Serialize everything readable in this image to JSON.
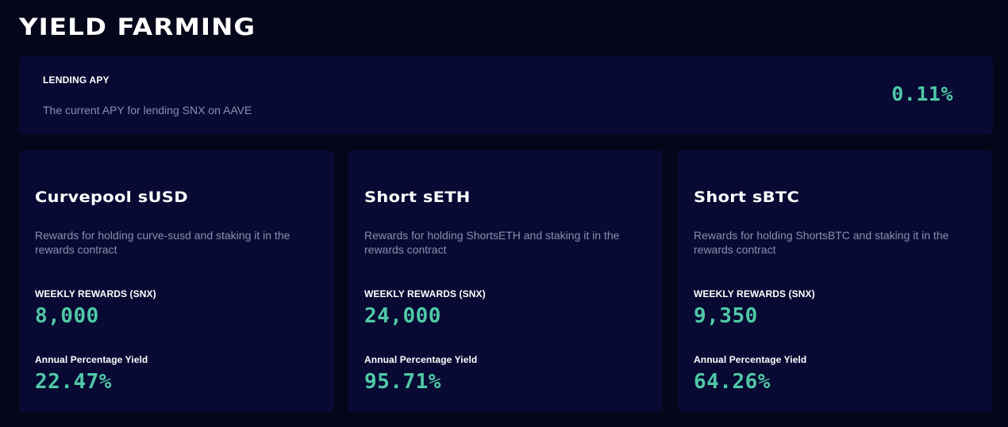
{
  "page": {
    "title": "YIELD FARMING"
  },
  "lending": {
    "label": "LENDING APY",
    "description": "The current APY for lending SNX on AAVE",
    "value": "0.11%"
  },
  "pools": [
    {
      "title": "Curvepool sUSD",
      "description": "Rewards for holding curve-susd and staking it in the rewards contract",
      "weekly_label": "WEEKLY REWARDS (SNX)",
      "weekly_value": "8,000",
      "apy_label": "Annual Percentage Yield",
      "apy_value": "22.47%"
    },
    {
      "title": "Short sETH",
      "description": "Rewards for holding ShortsETH and staking it in the rewards contract",
      "weekly_label": "WEEKLY REWARDS (SNX)",
      "weekly_value": "24,000",
      "apy_label": "Annual Percentage Yield",
      "apy_value": "95.71%"
    },
    {
      "title": "Short sBTC",
      "description": "Rewards for holding ShortsBTC and staking it in the rewards contract",
      "weekly_label": "WEEKLY REWARDS (SNX)",
      "weekly_value": "9,350",
      "apy_label": "Annual Percentage Yield",
      "apy_value": "64.26%"
    }
  ],
  "colors": {
    "background": "#06061b",
    "panel": "#080a33",
    "accent": "#4fc8a6",
    "muted_text": "#8b8fae",
    "text": "#ffffff"
  }
}
